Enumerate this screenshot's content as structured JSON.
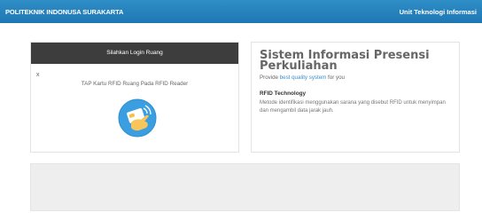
{
  "topbar": {
    "brand": "POLITEKNIK INDONUSA SURAKARTA",
    "unit": "Unit Teknologi Informasi",
    "color": "#2385c0"
  },
  "login_panel": {
    "header": "Silahkan Login Ruang",
    "close_mark": "x",
    "instruction": "TAP Kartu RFID Ruang Pada RFID Reader",
    "icon": "rfid-card-tap-icon"
  },
  "info_panel": {
    "title": "Sistem Informasi Presensi Perkuliahan",
    "provide_prefix": "Provide ",
    "provide_highlight": "best quality system",
    "provide_suffix": " for you",
    "section_title": "RFID Technology",
    "description": "Metode identifikasi menggunakan sarana yang disebut RFID untuk menyimpan dan mengambil data jarak jauh."
  },
  "colors": {
    "accent_blue": "#3a8fd0",
    "panel_header": "#3d3d3d",
    "bottom_panel": "#eeeeee"
  }
}
